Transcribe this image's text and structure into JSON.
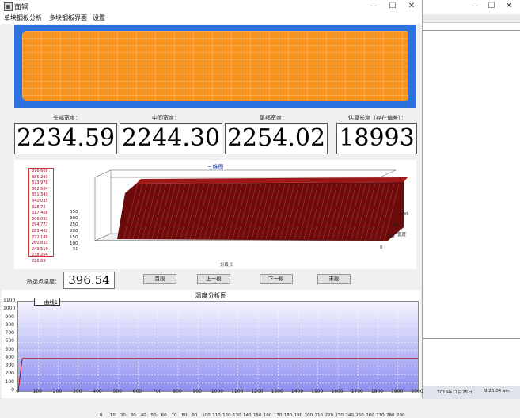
{
  "window": {
    "title": "面钢",
    "minimize_glyph": "—",
    "maximize_glyph": "☐",
    "close_glyph": "✕"
  },
  "menu": [
    "单块钢板分析",
    "多块钢板界面",
    "设置"
  ],
  "colors": {
    "slab": "#f7931e",
    "slab_background": "#2b72e0",
    "curve": "#c00000",
    "plot_top": "#f4f4ff",
    "plot_bottom": "#8e8ef0"
  },
  "measurements": [
    {
      "label": "头部宽度：",
      "value": "2234.59"
    },
    {
      "label": "中间宽度：",
      "value": "2244.30"
    },
    {
      "label": "尾部宽度：",
      "value": "2254.02"
    },
    {
      "label": "估算长度（存在偏差）：",
      "value": "18993"
    }
  ],
  "three_d_chart": {
    "title": "三维图",
    "legend_values": [
      "396.608",
      "385.293",
      "373.978",
      "362.664",
      "351.349",
      "340.035",
      "328.72",
      "317.406",
      "306.091",
      "294.777",
      "283.462",
      "272.148",
      "260.833",
      "249.519",
      "238.204",
      "226.89"
    ],
    "z_ticks": [
      "350",
      "300",
      "250",
      "200",
      "150",
      "100",
      "50"
    ],
    "x_ticks": [
      "0",
      "10",
      "20",
      "30",
      "40",
      "50",
      "60",
      "70",
      "80",
      "90",
      "100",
      "110",
      "120",
      "130",
      "140",
      "150",
      "160",
      "170",
      "180",
      "190",
      "200",
      "210",
      "220",
      "230",
      "240",
      "250",
      "260",
      "270",
      "280",
      "290"
    ],
    "x_label": "分段长",
    "y_ticks": [
      "300",
      "200",
      "100",
      "0"
    ],
    "y_label": "宽度"
  },
  "selected": {
    "label": "所选点温度：",
    "value": "396.54"
  },
  "nav_buttons": [
    "首段",
    "上一段",
    "下一段",
    "末段"
  ],
  "temperature_chart": {
    "title": "温度分析图",
    "legend": "曲线1",
    "y_ticks": [
      "1100",
      "1000",
      "900",
      "800",
      "700",
      "600",
      "500",
      "400",
      "300",
      "200",
      "100",
      "0"
    ],
    "x_ticks": [
      "0",
      "100",
      "200",
      "300",
      "400",
      "500",
      "600",
      "700",
      "800",
      "900",
      "1000",
      "1100",
      "1200",
      "1300",
      "1400",
      "1500",
      "1600",
      "1700",
      "1800",
      "1900",
      "2000"
    ]
  },
  "chart_data": {
    "type": "line",
    "title": "温度分析图",
    "series": [
      {
        "name": "曲线1",
        "x": [
          0,
          20,
          40,
          2000
        ],
        "y": [
          0,
          400,
          400,
          400
        ]
      }
    ],
    "xlim": [
      0,
      2000
    ],
    "ylim": [
      0,
      1100
    ],
    "grid": true,
    "legend_position": "top-left"
  },
  "taskbar": {
    "date": "2019年11月25日",
    "time": "9:26:04 am"
  }
}
